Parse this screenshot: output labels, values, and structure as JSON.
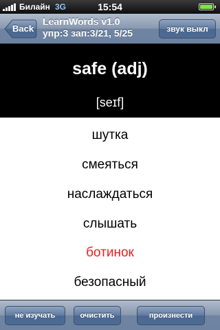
{
  "status_bar": {
    "carrier": "Билайн",
    "network": "3G",
    "time": "15:54",
    "battery_level": 1.0
  },
  "nav_bar": {
    "back_label": "Back",
    "title_line1": "LearnWords v1.0",
    "title_line2": "упр:3 зап:3/21, 5/25",
    "sound_label": "звук выкл"
  },
  "word": {
    "text": "safe (adj)",
    "transcription": "[seɪf]"
  },
  "options": [
    {
      "label": "шутка",
      "state": "normal"
    },
    {
      "label": "смеяться",
      "state": "normal"
    },
    {
      "label": "наслаждаться",
      "state": "normal"
    },
    {
      "label": "слышать",
      "state": "normal"
    },
    {
      "label": "ботинок",
      "state": "wrong"
    },
    {
      "label": "безопасный",
      "state": "normal"
    }
  ],
  "toolbar": {
    "skip_label": "не изучать",
    "clear_label": "очистить",
    "speak_label": "произнести"
  },
  "colors": {
    "wrong_answer": "#ee1d1d",
    "bar_blue": "#6d83a1",
    "header_bg": "#000000"
  }
}
